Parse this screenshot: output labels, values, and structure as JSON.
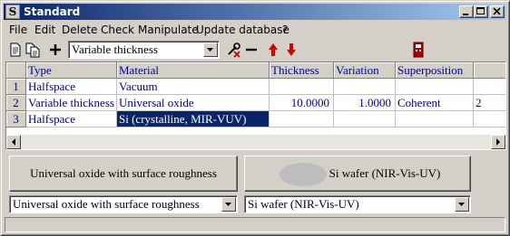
{
  "window": {
    "title": "Standard",
    "app_icon_letter": "S"
  },
  "menu": {
    "items": [
      "File",
      "Edit",
      "Delete",
      "Check",
      "Manipulate",
      "Update database",
      "?"
    ]
  },
  "toolbar": {
    "layer_type_selected": "Variable thickness",
    "icons": [
      "document-icon",
      "copy-document-icon",
      "plus-icon",
      "wrench-cross-icon",
      "minus-icon",
      "arrow-up-icon",
      "arrow-down-icon",
      "red-device-icon"
    ]
  },
  "table": {
    "columns": [
      "Type",
      "Material",
      "Thickness",
      "Variation",
      "Superposition",
      ""
    ],
    "rows": [
      {
        "num": "1",
        "type": "Halfspace",
        "material": "Vacuum",
        "thickness": "",
        "variation": "",
        "superposition": "",
        "extra": ""
      },
      {
        "num": "2",
        "type": "Variable thickness",
        "material": "Universal oxide",
        "thickness": "10.0000",
        "variation": "1.0000",
        "superposition": "Coherent",
        "extra": "2"
      },
      {
        "num": "3",
        "type": "Halfspace",
        "material": "Si (crystalline, MIR-VUV)",
        "thickness": "",
        "variation": "",
        "superposition": "",
        "extra": ""
      }
    ],
    "selected_row": 3
  },
  "bottom": {
    "left_button": "Universal oxide with surface roughness",
    "right_button": "Si wafer (NIR-Vis-UV)",
    "left_select": "Universal oxide with surface roughness",
    "right_select": "Si wafer (NIR-Vis-UV)"
  },
  "colors": {
    "titlebar_start": "#0a246a",
    "titlebar_end": "#a6caf0",
    "cell_text": "#0000a0",
    "selection": "#0a246a",
    "arrow_red": "#d40000"
  }
}
